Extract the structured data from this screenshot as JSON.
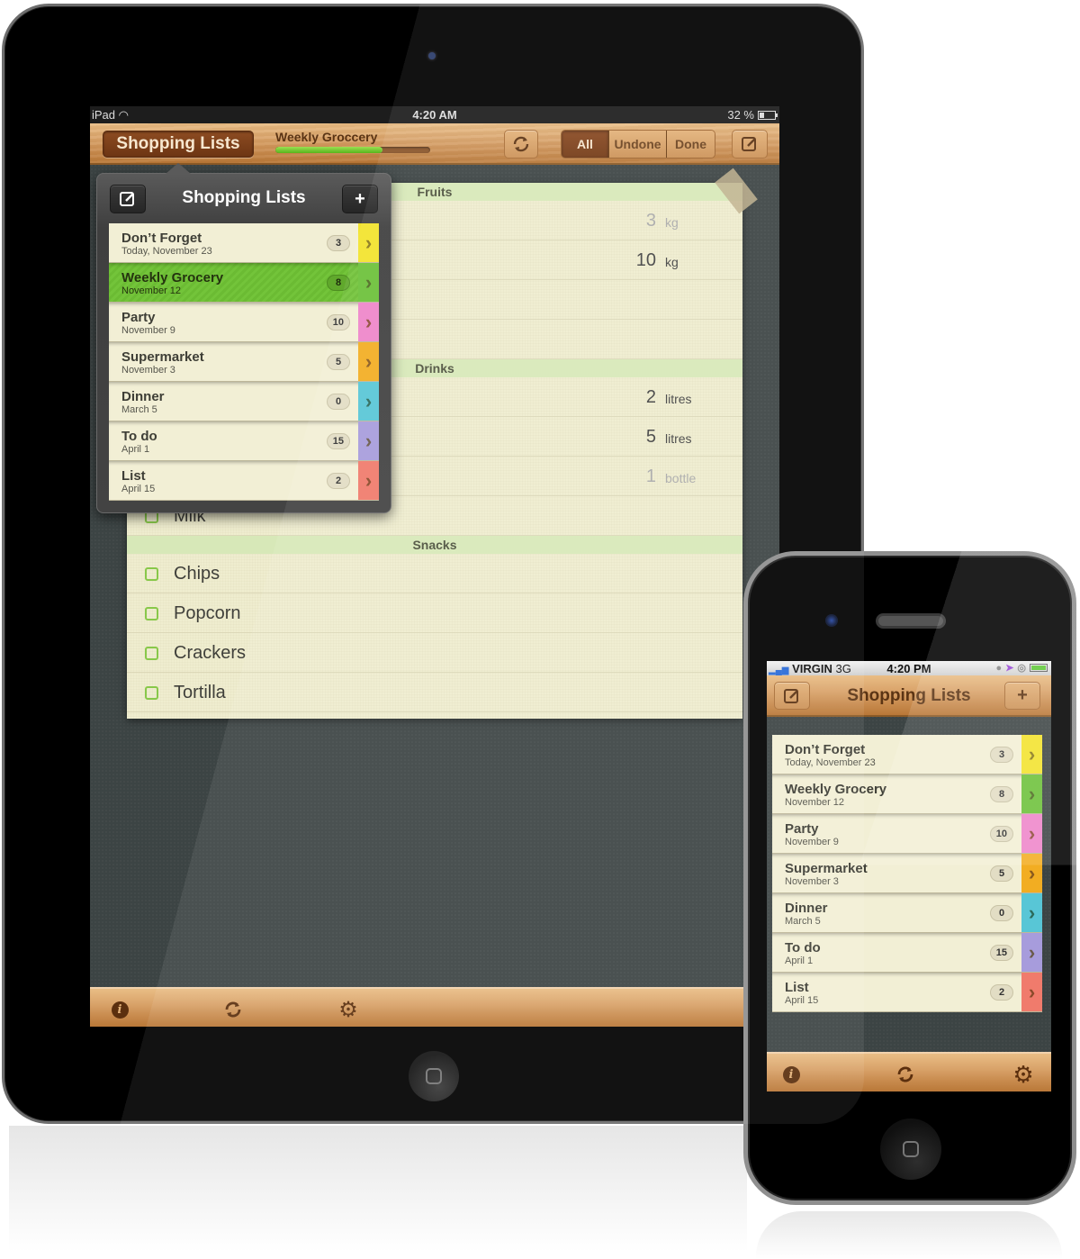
{
  "ipad": {
    "status": {
      "carrier": "iPad",
      "time": "4:20 AM",
      "battery": "32 %"
    },
    "toolbar": {
      "lists_button": "Shopping Lists",
      "current_list": "Weekly Groccery",
      "progress_percent": 69,
      "segments": [
        "All",
        "Undone",
        "Done"
      ],
      "active_segment": "All"
    },
    "sections": [
      {
        "title": "Fruits",
        "items": [
          {
            "name": "",
            "qty": "3",
            "unit": "kg",
            "done": true
          },
          {
            "name": "",
            "qty": "10",
            "unit": "kg",
            "done": false
          },
          {
            "name": "",
            "qty": "",
            "unit": "",
            "done": false
          },
          {
            "name": "",
            "qty": "",
            "unit": "",
            "done": false
          }
        ]
      },
      {
        "title": "Drinks",
        "items": [
          {
            "name": "",
            "qty": "2",
            "unit": "litres",
            "done": false
          },
          {
            "name": "",
            "qty": "5",
            "unit": "litres",
            "done": false
          },
          {
            "name": "",
            "qty": "1",
            "unit": "bottle",
            "done": true
          },
          {
            "name": "Milk",
            "qty": "",
            "unit": "",
            "done": false
          }
        ]
      },
      {
        "title": "Snacks",
        "items": [
          {
            "name": "Chips",
            "qty": "",
            "unit": "",
            "done": false
          },
          {
            "name": "Popcorn",
            "qty": "",
            "unit": "",
            "done": false
          },
          {
            "name": "Crackers",
            "qty": "",
            "unit": "",
            "done": false
          },
          {
            "name": "Tortilla",
            "qty": "",
            "unit": "",
            "done": false
          }
        ]
      }
    ],
    "popover": {
      "title": "Shopping Lists",
      "add_label": "+"
    },
    "bottom_icons": [
      "info-icon",
      "sync-icon",
      "gear-icon"
    ]
  },
  "lists": [
    {
      "title": "Don’t Forget",
      "date": "Today, November 23",
      "count": "3",
      "color": "#f2e32c",
      "chev": "#8b7a1a"
    },
    {
      "title": "Weekly Grocery",
      "date": "November 12",
      "count": "8",
      "color": "#6cc139",
      "chev": "#4f6b22"
    },
    {
      "title": "Party",
      "date": "November 9",
      "count": "10",
      "color": "#ee85c9",
      "chev": "#8f4c3a"
    },
    {
      "title": "Supermarket",
      "date": "November 3",
      "count": "5",
      "color": "#f2ad22",
      "chev": "#8a5a1e"
    },
    {
      "title": "Dinner",
      "date": "March 5",
      "count": "0",
      "color": "#58c6d6",
      "chev": "#2c6a5a"
    },
    {
      "title": "To do",
      "date": "April 1",
      "count": "15",
      "color": "#a79cdc",
      "chev": "#6a5a4a"
    },
    {
      "title": "List",
      "date": "April 15",
      "count": "2",
      "color": "#f07b6c",
      "chev": "#8a4a2a"
    }
  ],
  "ipad_selected_list": 1,
  "iphone": {
    "status": {
      "carrier": "VIRGIN",
      "network": "3G",
      "time": "4:20 PM"
    },
    "nav_title": "Shopping Lists",
    "add_label": "+"
  }
}
